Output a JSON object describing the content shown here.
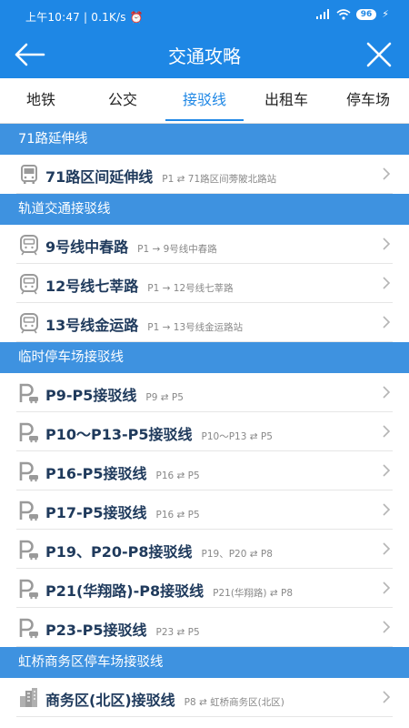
{
  "statusbar": {
    "left_text": "上午10:47 | 0.1K/s ⏰",
    "battery": "96",
    "signal": "signal-icon",
    "wifi": "wifi-icon"
  },
  "header": {
    "title": "交通攻略",
    "back_icon": "arrow-left-icon",
    "close_icon": "close-icon"
  },
  "tabs": [
    {
      "label": "地铁"
    },
    {
      "label": "公交"
    },
    {
      "label": "接驳线",
      "active": true
    },
    {
      "label": "出租车"
    },
    {
      "label": "停车场"
    }
  ],
  "sections": [
    {
      "title": "71路延伸线",
      "items": [
        {
          "icon": "bus-icon",
          "name": "71路区间延伸线",
          "desc": "P1 ⇄ 71路区间蒡陂北路站"
        }
      ]
    },
    {
      "title": "轨道交通接驳线",
      "items": [
        {
          "icon": "metro-icon",
          "name": "9号线中春路",
          "desc": "P1 → 9号线中春路"
        },
        {
          "icon": "metro-icon",
          "name": "12号线七莘路",
          "desc": "P1 → 12号线七莘路"
        },
        {
          "icon": "metro-icon",
          "name": "13号线金运路",
          "desc": "P1 → 13号线金运路站"
        }
      ]
    },
    {
      "title": "临时停车场接驳线",
      "items": [
        {
          "icon": "parking-icon",
          "name": "P9-P5接驳线",
          "desc": "P9 ⇄ P5"
        },
        {
          "icon": "parking-icon",
          "name": "P10～P13-P5接驳线",
          "desc": "P10～P13 ⇄ P5"
        },
        {
          "icon": "parking-icon",
          "name": "P16-P5接驳线",
          "desc": "P16 ⇄ P5"
        },
        {
          "icon": "parking-icon",
          "name": "P17-P5接驳线",
          "desc": "P16 ⇄ P5"
        },
        {
          "icon": "parking-icon",
          "name": "P19、P20-P8接驳线",
          "desc": "P19、P20 ⇄ P8"
        },
        {
          "icon": "parking-icon",
          "name": "P21(华翔路)-P8接驳线",
          "desc": "P21(华翔路) ⇄ P8"
        },
        {
          "icon": "parking-icon",
          "name": "P23-P5接驳线",
          "desc": "P23 ⇄ P5"
        }
      ]
    },
    {
      "title": "虹桥商务区停车场接驳线",
      "items": [
        {
          "icon": "building-icon",
          "name": "商务区(北区)接驳线",
          "desc": "P8 ⇄ 虹桥商务区(北区)"
        }
      ]
    }
  ],
  "colors": {
    "primary": "#1e87e5",
    "section_bg": "#3e92e0",
    "item_text": "#1f3a5c",
    "desc_text": "#888888"
  }
}
